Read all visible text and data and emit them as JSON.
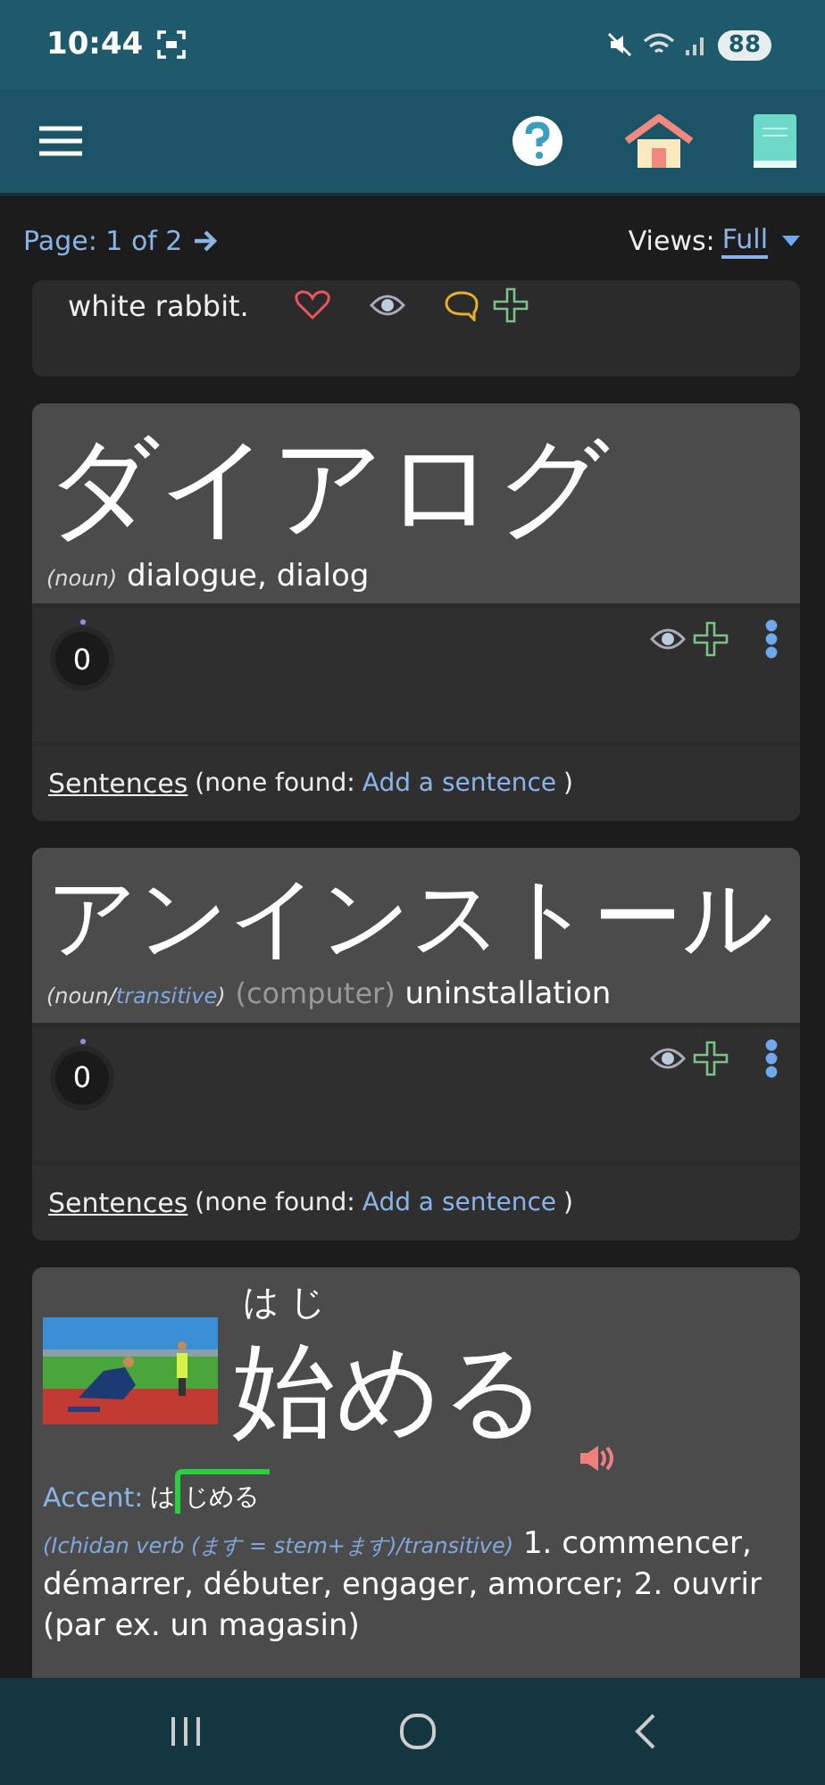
{
  "status_bar": {
    "time": "10:44",
    "battery": "88"
  },
  "pager": {
    "page": "Page: 1 of 2",
    "views_label": "Views:",
    "view": "Full"
  },
  "entries": [
    {
      "kind": "sentence_tail",
      "text": "white rabbit."
    },
    {
      "kind": "word",
      "word": "ダイアログ",
      "pos": [
        {
          "text": "(noun)",
          "kind": "plain"
        }
      ],
      "definition": "dialogue, dialog",
      "count": "0",
      "sentences_label": "Sentences",
      "none_found": "(none found:",
      "add_link": "Add a sentence",
      "close": ")"
    },
    {
      "kind": "word",
      "word": "アンインストール",
      "pos": [
        {
          "text": "(noun/",
          "kind": "plain"
        },
        {
          "text": "transitive",
          "kind": "link"
        },
        {
          "text": ")",
          "kind": "plain"
        }
      ],
      "field": "(computer)",
      "definition": "uninstallation",
      "count": "0",
      "sentences_label": "Sentences",
      "none_found": "(none found:",
      "add_link": "Add a sentence",
      "close": ")"
    },
    {
      "kind": "word_full",
      "word": "始める",
      "furigana": "はじ",
      "accent": {
        "label": "Accent:",
        "low": "は",
        "high": "じめる"
      },
      "pos": [
        {
          "text": "(Ichidan verb (ます = stem+ます)/transitive)",
          "kind": "link"
        }
      ],
      "definition": "1. commencer, démarrer, débuter, engager, amorcer; 2. ouvrir (par ex. un magasin)"
    }
  ]
}
